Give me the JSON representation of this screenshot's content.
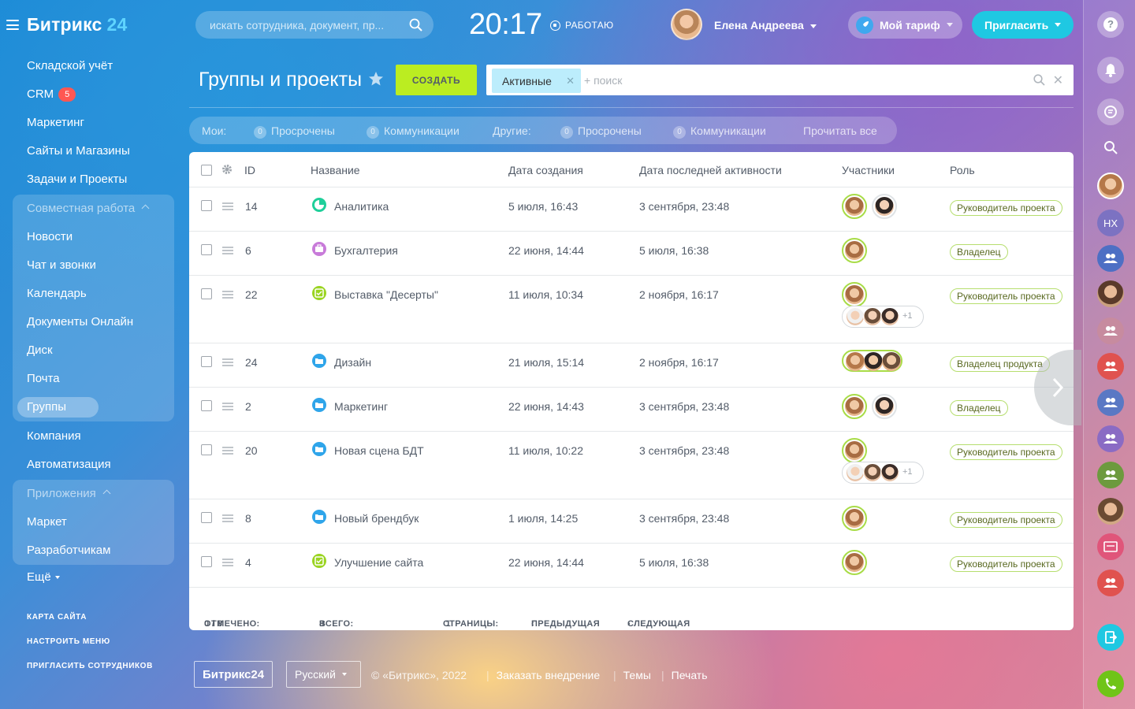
{
  "header": {
    "logo_text": "Битрикс",
    "logo_num": "24",
    "search_placeholder": "искать сотрудника, документ, пр...",
    "clock": "20:17",
    "work_status": "РАБОТАЮ",
    "user_name": "Елена Андреева",
    "tariff_label": "Мой тариф",
    "invite_label": "Пригласить"
  },
  "sidebar": {
    "items": [
      "Складской учёт",
      "CRM",
      "Маркетинг",
      "Сайты и Магазины",
      "Задачи и Проекты"
    ],
    "crm_badge": "5",
    "collab_head": "Совместная работа",
    "collab_items": [
      "Новости",
      "Чат и звонки",
      "Календарь",
      "Документы Онлайн",
      "Диск",
      "Почта",
      "Группы"
    ],
    "company": "Компания",
    "automation": "Автоматизация",
    "apps_head": "Приложения",
    "apps_items": [
      "Маркет",
      "Разработчикам"
    ],
    "more": "Ещё",
    "links": [
      "КАРТА САЙТА",
      "НАСТРОИТЬ МЕНЮ",
      "ПРИГЛАСИТЬ СОТРУДНИКОВ"
    ]
  },
  "page": {
    "title": "Группы и проекты",
    "create_label": "СОЗДАТЬ",
    "filter_tag": "Активные",
    "filter_placeholder": "+ поиск"
  },
  "counters": {
    "mine_label": "Мои:",
    "others_label": "Другие:",
    "overdue": "Просрочены",
    "comms": "Коммуникации",
    "zero": "0",
    "read_all": "Прочитать все"
  },
  "grid": {
    "columns": [
      "ID",
      "Название",
      "Дата создания",
      "Дата последней активности",
      "Участники",
      "Роль"
    ],
    "rows": [
      {
        "id": "14",
        "name": "Аналитика",
        "created": "5 июля, 16:43",
        "activity": "3 сентября, 23:48",
        "role": "Руководитель проекта",
        "icon": "analytics-icon",
        "color": "#1fcf9a"
      },
      {
        "id": "6",
        "name": "Бухгалтерия",
        "created": "22 июня, 14:44",
        "activity": "5 июля, 16:38",
        "role": "Владелец",
        "icon": "briefcase-icon",
        "color": "#c87bd9"
      },
      {
        "id": "22",
        "name": "Выставка \"Десерты\"",
        "created": "11 июля, 10:34",
        "activity": "2 ноября, 16:17",
        "role": "Руководитель проекта",
        "icon": "project-icon",
        "color": "#9ad421",
        "extra": "+1"
      },
      {
        "id": "24",
        "name": "Дизайн",
        "created": "21 июля, 15:14",
        "activity": "2 ноября, 16:17",
        "role": "Владелец продукта",
        "icon": "folder-icon",
        "color": "#2fa5ea"
      },
      {
        "id": "2",
        "name": "Маркетинг",
        "created": "22 июня, 14:43",
        "activity": "3 сентября, 23:48",
        "role": "Владелец",
        "icon": "folder-icon",
        "color": "#2fa5ea"
      },
      {
        "id": "20",
        "name": "Новая сцена БДТ",
        "created": "11 июля, 10:22",
        "activity": "3 сентября, 23:48",
        "role": "Руководитель проекта",
        "icon": "folder-icon",
        "color": "#2fa5ea",
        "extra": "+1"
      },
      {
        "id": "8",
        "name": "Новый брендбук",
        "created": "1 июля, 14:25",
        "activity": "3 сентября, 23:48",
        "role": "Руководитель проекта",
        "icon": "folder-icon",
        "color": "#2fa5ea"
      },
      {
        "id": "4",
        "name": "Улучшение сайта",
        "created": "22 июня, 14:44",
        "activity": "5 июля, 16:38",
        "role": "Руководитель проекта",
        "icon": "project-icon",
        "color": "#9ad421"
      }
    ],
    "footer": {
      "marked_label": "ОТМЕЧЕНО:",
      "marked_value": "0 / 8",
      "total_label": "ВСЕГО:",
      "total_value": "8",
      "pages_label": "СТРАНИЦЫ:",
      "pages_value": "1",
      "prev": "ПРЕДЫДУЩАЯ",
      "next": "СЛЕДУЮЩАЯ"
    }
  },
  "right_strip": {
    "initials": "НХ"
  },
  "footer": {
    "logo": "Битрикс24",
    "language": "Русский",
    "copyright": "© «Битрикс», 2022",
    "order": "Заказать внедрение",
    "themes": "Темы",
    "print": "Печать"
  }
}
